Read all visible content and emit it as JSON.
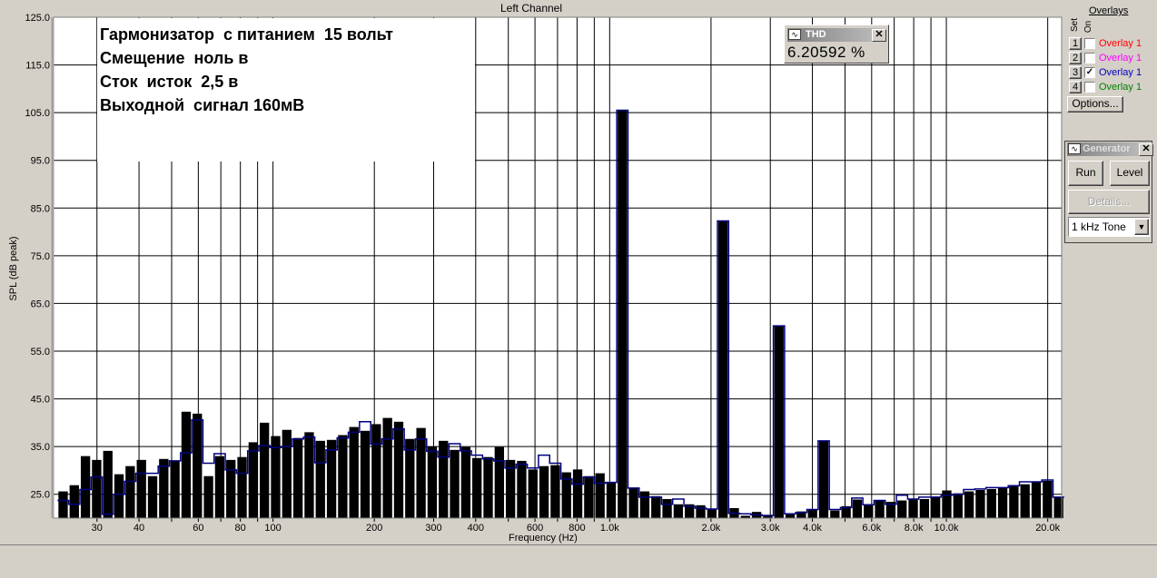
{
  "window": {
    "title": "Left Channel"
  },
  "annotation": [
    "Гармонизатор  с питанием  15 вольт",
    "Смещение  ноль в",
    "Сток  исток  2,5 в",
    "Выходной  сигнал 160мВ"
  ],
  "thd": {
    "title": "THD",
    "value": "6.20592 %",
    "icon": "waveform-icon"
  },
  "overlays": {
    "header": "Overlays",
    "set_label": "Set",
    "on_label": "On",
    "items": [
      {
        "set": "1",
        "label": "Overlay 1",
        "checked": false,
        "color": "#ff0000"
      },
      {
        "set": "2",
        "label": "Overlay 1",
        "checked": false,
        "color": "#ff00ff"
      },
      {
        "set": "3",
        "label": "Overlay 1",
        "checked": true,
        "color": "#0000c0"
      },
      {
        "set": "4",
        "label": "Overlay 1",
        "checked": false,
        "color": "#008000"
      }
    ],
    "options_label": "Options..."
  },
  "generator": {
    "title": "Generator",
    "run_label": "Run",
    "level_label": "Level",
    "details_label": "Details...",
    "tone_value": "1 kHz Tone"
  },
  "chart_data": {
    "type": "bar",
    "xlabel": "Frequency (Hz)",
    "ylabel": "SPL (dB peak)",
    "xscale": "log",
    "xlim": [
      22.3,
      22000
    ],
    "ylim": [
      20,
      125
    ],
    "grid": true,
    "yticks": [
      "125.0",
      "115.0",
      "105.0",
      "95.0",
      "85.0",
      "75.0",
      "65.0",
      "55.0",
      "45.0",
      "35.0",
      "25.0"
    ],
    "ytick_values": [
      125,
      115,
      105,
      95,
      85,
      75,
      65,
      55,
      45,
      35,
      25
    ],
    "xticks": [
      {
        "f": 30,
        "label": "30"
      },
      {
        "f": 40,
        "label": "40"
      },
      {
        "f": 60,
        "label": "60"
      },
      {
        "f": 80,
        "label": "80"
      },
      {
        "f": 100,
        "label": "100"
      },
      {
        "f": 200,
        "label": "200"
      },
      {
        "f": 300,
        "label": "300"
      },
      {
        "f": 400,
        "label": "400"
      },
      {
        "f": 600,
        "label": "600"
      },
      {
        "f": 800,
        "label": "800"
      },
      {
        "f": 1000,
        "label": "1.0k"
      },
      {
        "f": 2000,
        "label": "2.0k"
      },
      {
        "f": 3000,
        "label": "3.0k"
      },
      {
        "f": 4000,
        "label": "4.0k"
      },
      {
        "f": 6000,
        "label": "6.0k"
      },
      {
        "f": 8000,
        "label": "8.0k"
      },
      {
        "f": 10000,
        "label": "10.0k"
      },
      {
        "f": 20000,
        "label": "20.0k"
      }
    ],
    "gridlines_hz": [
      30,
      40,
      50,
      60,
      70,
      80,
      90,
      100,
      200,
      300,
      400,
      500,
      600,
      700,
      800,
      900,
      1000,
      2000,
      3000,
      4000,
      5000,
      6000,
      7000,
      8000,
      9000,
      10000,
      20000
    ],
    "first_band_center_hz": 23.8,
    "bands_per_decade": 30.1,
    "series": [
      {
        "name": "Measurement",
        "color": "#000000",
        "values": [
          25.6,
          26.9,
          33,
          32.2,
          34.1,
          29.2,
          30.9,
          32.2,
          28.8,
          32.4,
          32,
          42.3,
          41.9,
          28.8,
          33,
          32.2,
          32.8,
          35.9,
          40,
          37.2,
          38.5,
          36.8,
          38,
          36.2,
          36.4,
          37.4,
          39.1,
          38.3,
          39.7,
          41,
          40.2,
          36.6,
          38.9,
          35,
          36.2,
          34.3,
          34.9,
          32.6,
          32.8,
          34.9,
          32.2,
          32,
          30.2,
          30.9,
          31.1,
          29.6,
          30.2,
          28.8,
          29.4,
          27.4,
          105.5,
          26.3,
          25.6,
          24.6,
          24,
          22.9,
          22.9,
          22.7,
          21.8,
          82.3,
          22.1,
          20.5,
          21.3,
          20.7,
          60.3,
          21,
          21.4,
          21.8,
          36.1,
          21.6,
          22.5,
          23.9,
          22.8,
          23.7,
          23.4,
          23.7,
          24,
          24,
          24.5,
          25.8,
          25.2,
          25.6,
          25.9,
          26.1,
          26.3,
          26.8,
          27.1,
          27.5,
          27.8,
          24.4
        ]
      },
      {
        "name": "Overlay 1",
        "color": "#00007f",
        "values": [
          23.7,
          22.9,
          26,
          28.6,
          20.8,
          25,
          27.7,
          29.4,
          29.4,
          30.9,
          32,
          33.7,
          40.6,
          31.5,
          33.5,
          30.1,
          29.4,
          34.1,
          35.2,
          34.8,
          35,
          36.6,
          37,
          31.6,
          34.3,
          36.8,
          38,
          40.2,
          35.5,
          36.6,
          38.7,
          34.3,
          36.6,
          34,
          32.8,
          35.6,
          34.1,
          33.2,
          32.4,
          32,
          30.5,
          31.3,
          30.5,
          33.2,
          31.5,
          28.2,
          27.1,
          28.6,
          27.3,
          27.5,
          105.5,
          26.3,
          24.4,
          24.4,
          22.9,
          24,
          22.5,
          22.1,
          21.9,
          82.3,
          21,
          20.9,
          20.7,
          20.5,
          60.3,
          20.9,
          21.2,
          21.8,
          36.2,
          21.8,
          22.2,
          24.2,
          22.8,
          23.7,
          22.9,
          24.8,
          24,
          24.4,
          24.4,
          24.8,
          25,
          26,
          26.1,
          26.4,
          26.4,
          26.8,
          27.6,
          27.6,
          28,
          24.4
        ]
      }
    ]
  }
}
